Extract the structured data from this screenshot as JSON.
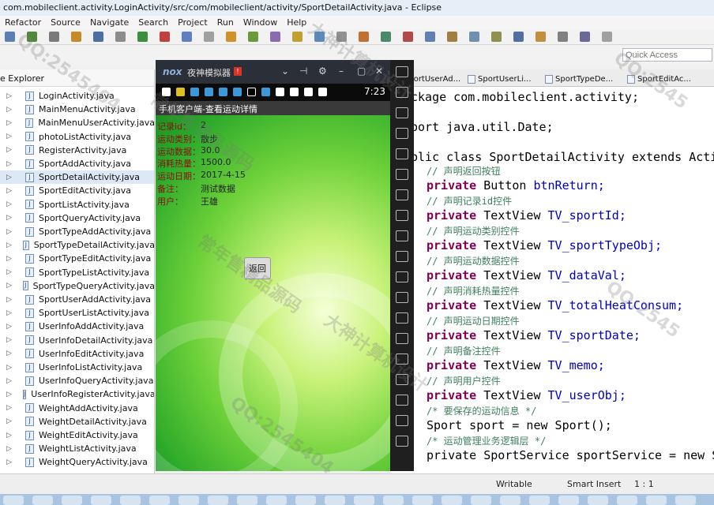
{
  "window": {
    "title": "com.mobileclient.activity.LoginActivity/src/com/mobileclient/activity/SportDetailActivity.java - Eclipse"
  },
  "menu": [
    "Refactor",
    "Source",
    "Navigate",
    "Search",
    "Project",
    "Run",
    "Window",
    "Help"
  ],
  "quick_access": {
    "placeholder": "Quick Access"
  },
  "explorer": {
    "title": "e Explorer",
    "files": [
      "LoginActivity.java",
      "MainMenuActivity.java",
      "MainMenuUserActivity.java",
      "photoListActivity.java",
      "RegisterActivity.java",
      "SportAddActivity.java",
      "SportDetailActivity.java",
      "SportEditActivity.java",
      "SportListActivity.java",
      "SportQueryActivity.java",
      "SportTypeAddActivity.java",
      "SportTypeDetailActivity.java",
      "SportTypeEditActivity.java",
      "SportTypeListActivity.java",
      "SportTypeQueryActivity.java",
      "SportUserAddActivity.java",
      "SportUserListActivity.java",
      "UserInfoAddActivity.java",
      "UserInfoDetailActivity.java",
      "UserInfoEditActivity.java",
      "UserInfoListActivity.java",
      "UserInfoQueryActivity.java",
      "UserInfoRegisterActivity.java",
      "WeightAddActivity.java",
      "WeightDetailActivity.java",
      "WeightEditActivity.java",
      "WeightListActivity.java",
      "WeightQueryActivity.java"
    ],
    "selected": "SportDetailActivity.java"
  },
  "editor_tabs": [
    "SportUserAd...",
    "SportUserLi...",
    "SportTypeDe...",
    "SportEditAc..."
  ],
  "code": [
    {
      "type": "plain",
      "text": "ckage com.mobileclient.activity;"
    },
    {
      "type": "plain",
      "text": "port java.util.Date;"
    },
    {
      "type": "class",
      "text": "blic class SportDetailActivity extends Activ"
    },
    {
      "type": "comment",
      "text": "// 声明返回按钮"
    },
    {
      "type": "decl",
      "kw": "private",
      "typ": "Button",
      "name": "btnReturn;"
    },
    {
      "type": "comment",
      "text": "// 声明记录id控件"
    },
    {
      "type": "decl",
      "kw": "private",
      "typ": "TextView",
      "name": "TV_sportId;"
    },
    {
      "type": "comment",
      "text": "// 声明运动类别控件"
    },
    {
      "type": "decl",
      "kw": "private",
      "typ": "TextView",
      "name": "TV_sportTypeObj;"
    },
    {
      "type": "comment",
      "text": "// 声明运动数据控件"
    },
    {
      "type": "decl",
      "kw": "private",
      "typ": "TextView",
      "name": "TV_dataVal;"
    },
    {
      "type": "comment",
      "text": "// 声明消耗热量控件"
    },
    {
      "type": "decl",
      "kw": "private",
      "typ": "TextView",
      "name": "TV_totalHeatConsum;"
    },
    {
      "type": "comment",
      "text": "// 声明运动日期控件"
    },
    {
      "type": "decl",
      "kw": "private",
      "typ": "TextView",
      "name": "TV_sportDate;"
    },
    {
      "type": "comment",
      "text": "// 声明备注控件"
    },
    {
      "type": "decl",
      "kw": "private",
      "typ": "TextView",
      "name": "TV_memo;"
    },
    {
      "type": "comment",
      "text": "// 声明用户控件"
    },
    {
      "type": "decl",
      "kw": "private",
      "typ": "TextView",
      "name": "TV_userObj;"
    },
    {
      "type": "comment",
      "text": "/* 要保存的运动信息 */"
    },
    {
      "type": "plain",
      "text": "Sport sport = new Sport();"
    },
    {
      "type": "comment",
      "text": "/* 运动管理业务逻辑层 */"
    },
    {
      "type": "plain",
      "text": "private SportService sportService = new Sp"
    }
  ],
  "emulator": {
    "logo": "nox",
    "name": "夜神模拟器",
    "badge": "!",
    "time": "7:23",
    "app_title": "手机客户端-查看运动详情",
    "details": [
      {
        "label": "记录id：",
        "value": "2"
      },
      {
        "label": "运动类别：",
        "value": "散步"
      },
      {
        "label": "运动数据：",
        "value": "30.0"
      },
      {
        "label": "消耗热量：",
        "value": "1500.0"
      },
      {
        "label": "运动日期：",
        "value": "2017-4-15"
      },
      {
        "label": "备注：",
        "value": "测试数据"
      },
      {
        "label": "用户：",
        "value": "王雄"
      }
    ],
    "back_button": "返回"
  },
  "status": {
    "mode": "Writable",
    "insert": "Smart Insert",
    "position": "1 : 1"
  },
  "watermarks": [
    "QQ:2545404",
    "常年售精品源码",
    "大神计算机设计",
    "QQ:2545",
    "常年售精品源码",
    "大神计算机设计",
    "QQ:2545404",
    "QQ:2545"
  ]
}
